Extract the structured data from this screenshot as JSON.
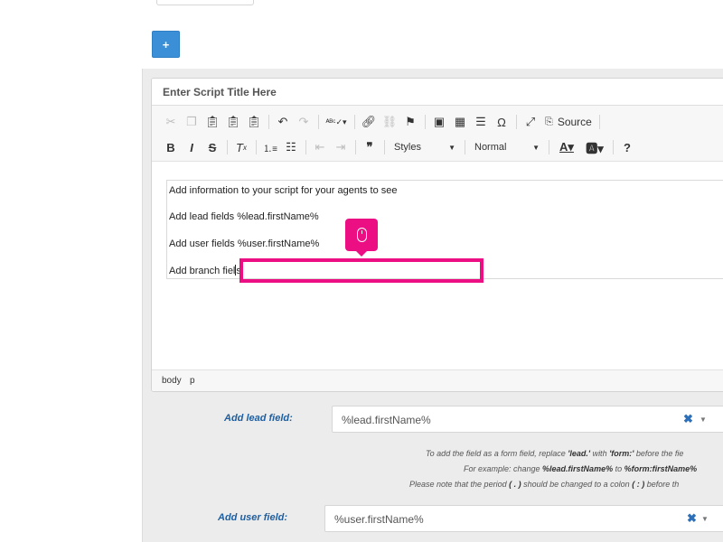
{
  "top": {
    "add_button_label": "+"
  },
  "editor": {
    "title_placeholder": "Enter Script Title Here",
    "toolbar": {
      "source_label": "Source",
      "styles_label": "Styles",
      "format_label": "Normal",
      "row1_icons": [
        "cut-icon",
        "copy-icon",
        "paste-icon",
        "paste-text-icon",
        "paste-word-icon",
        "undo-icon",
        "redo-icon",
        "spellcheck-icon",
        "link-icon",
        "unlink-icon",
        "anchor-icon",
        "image-icon",
        "table-icon",
        "horizontal-rule-icon",
        "special-char-icon",
        "maximize-icon",
        "source-icon"
      ],
      "row2_icons": [
        "bold-icon",
        "italic-icon",
        "strikethrough-icon",
        "remove-format-icon",
        "numbered-list-icon",
        "bulleted-list-icon",
        "outdent-icon",
        "indent-icon",
        "blockquote-icon",
        "text-color-icon",
        "background-color-icon",
        "help-icon"
      ]
    },
    "content": {
      "p1": "Add information to your script for your agents to see",
      "p2": "Add lead fields %lead.firstName%",
      "p3": "Add user fields %user.firstName%",
      "p4_before_caret": "Add branch fiel",
      "p4_after_caret": "s"
    },
    "status_path": [
      "body",
      "p"
    ]
  },
  "fields": {
    "lead_label": "Add lead field:",
    "lead_value": "%lead.firstName%",
    "user_label": "Add user field:",
    "user_value": "%user.firstName%",
    "clear_glyph": "✖",
    "dropdown_glyph": "▼"
  },
  "help": {
    "line1_a": "To add the field as a form field, replace ",
    "line1_b": "'lead.'",
    "line1_c": " with ",
    "line1_d": "'form:'",
    "line1_e": " before the fie",
    "line2_a": "For example: change ",
    "line2_b": "%lead.firstName%",
    "line2_c": " to ",
    "line2_d": "%form:firstName%",
    "line3_a": "Please note that the period ",
    "line3_b": "( . )",
    "line3_c": " should be changed to a colon ",
    "line3_d": "( : )",
    "line3_e": " before th"
  },
  "annotation": {
    "color": "#ec0e83",
    "icon": "mouse-icon"
  },
  "colors": {
    "primary_button": "#3a8fd6",
    "label_blue": "#1f5fa0",
    "highlight": "#ec0e83"
  }
}
